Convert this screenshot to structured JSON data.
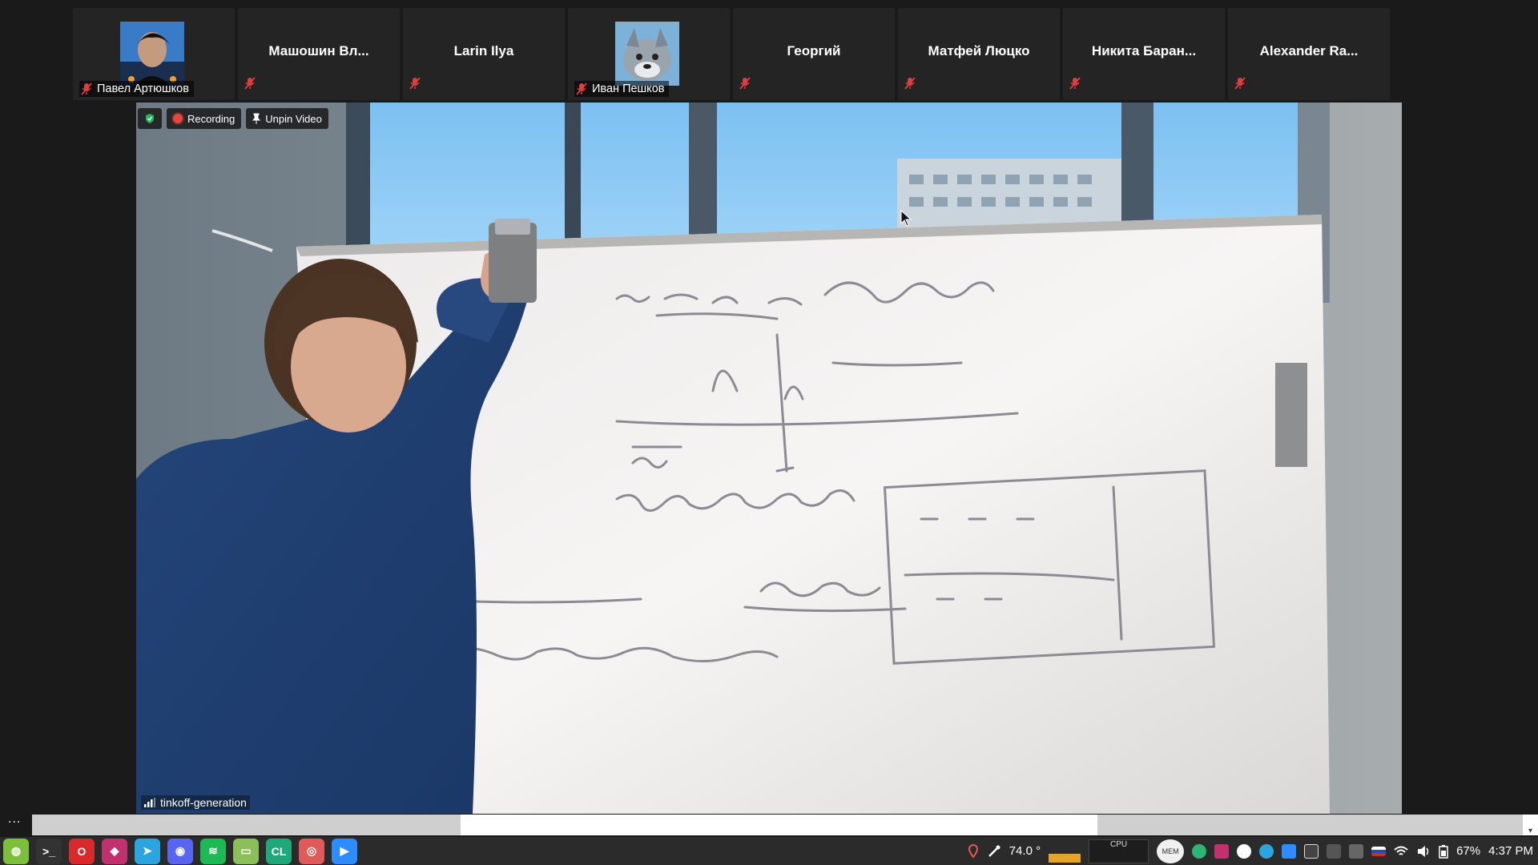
{
  "participants": [
    {
      "name": "Павел Артюшков",
      "has_avatar": true,
      "muted": true
    },
    {
      "name": "Машошин Вл...",
      "has_avatar": false,
      "muted": true
    },
    {
      "name": "Larin Ilya",
      "has_avatar": false,
      "muted": true
    },
    {
      "name": "Иван Пешков",
      "has_avatar": true,
      "muted": true
    },
    {
      "name": "Георгий",
      "has_avatar": false,
      "muted": true
    },
    {
      "name": "Матфей Люцко",
      "has_avatar": false,
      "muted": true
    },
    {
      "name": "Никита Баран...",
      "has_avatar": false,
      "muted": true
    },
    {
      "name": "Alexander Ra...",
      "has_avatar": false,
      "muted": true
    }
  ],
  "video_toolbar": {
    "recording_label": "Recording",
    "unpin_label": "Unpin Video"
  },
  "video_source": {
    "name": "tinkoff-generation"
  },
  "more_label": "...",
  "taskbar": {
    "apps": [
      {
        "name": "mint-menu-icon",
        "color": "#7bbf3a",
        "glyph": "◍"
      },
      {
        "name": "terminal-icon",
        "color": "#333333",
        "glyph": ">_"
      },
      {
        "name": "opera-icon",
        "color": "#d72b2b",
        "glyph": "O"
      },
      {
        "name": "jetbrains-icon",
        "color": "#c2306d",
        "glyph": "◆"
      },
      {
        "name": "telegram-icon",
        "color": "#2ba5e0",
        "glyph": "➤"
      },
      {
        "name": "discord-icon",
        "color": "#5865f2",
        "glyph": "◉"
      },
      {
        "name": "spotify-icon",
        "color": "#1db954",
        "glyph": "≋"
      },
      {
        "name": "files-icon",
        "color": "#8bbf5a",
        "glyph": "▭"
      },
      {
        "name": "clion-icon",
        "color": "#1fa87a",
        "glyph": "CL"
      },
      {
        "name": "app-icon",
        "color": "#e05a5a",
        "glyph": "◎"
      },
      {
        "name": "zoom-icon",
        "color": "#2d8cff",
        "glyph": "▶"
      }
    ],
    "temperature": "74.0 °",
    "cpu_label": "CPU",
    "mem_label": "MEM",
    "battery": "67%",
    "clock": "4:37 PM"
  }
}
